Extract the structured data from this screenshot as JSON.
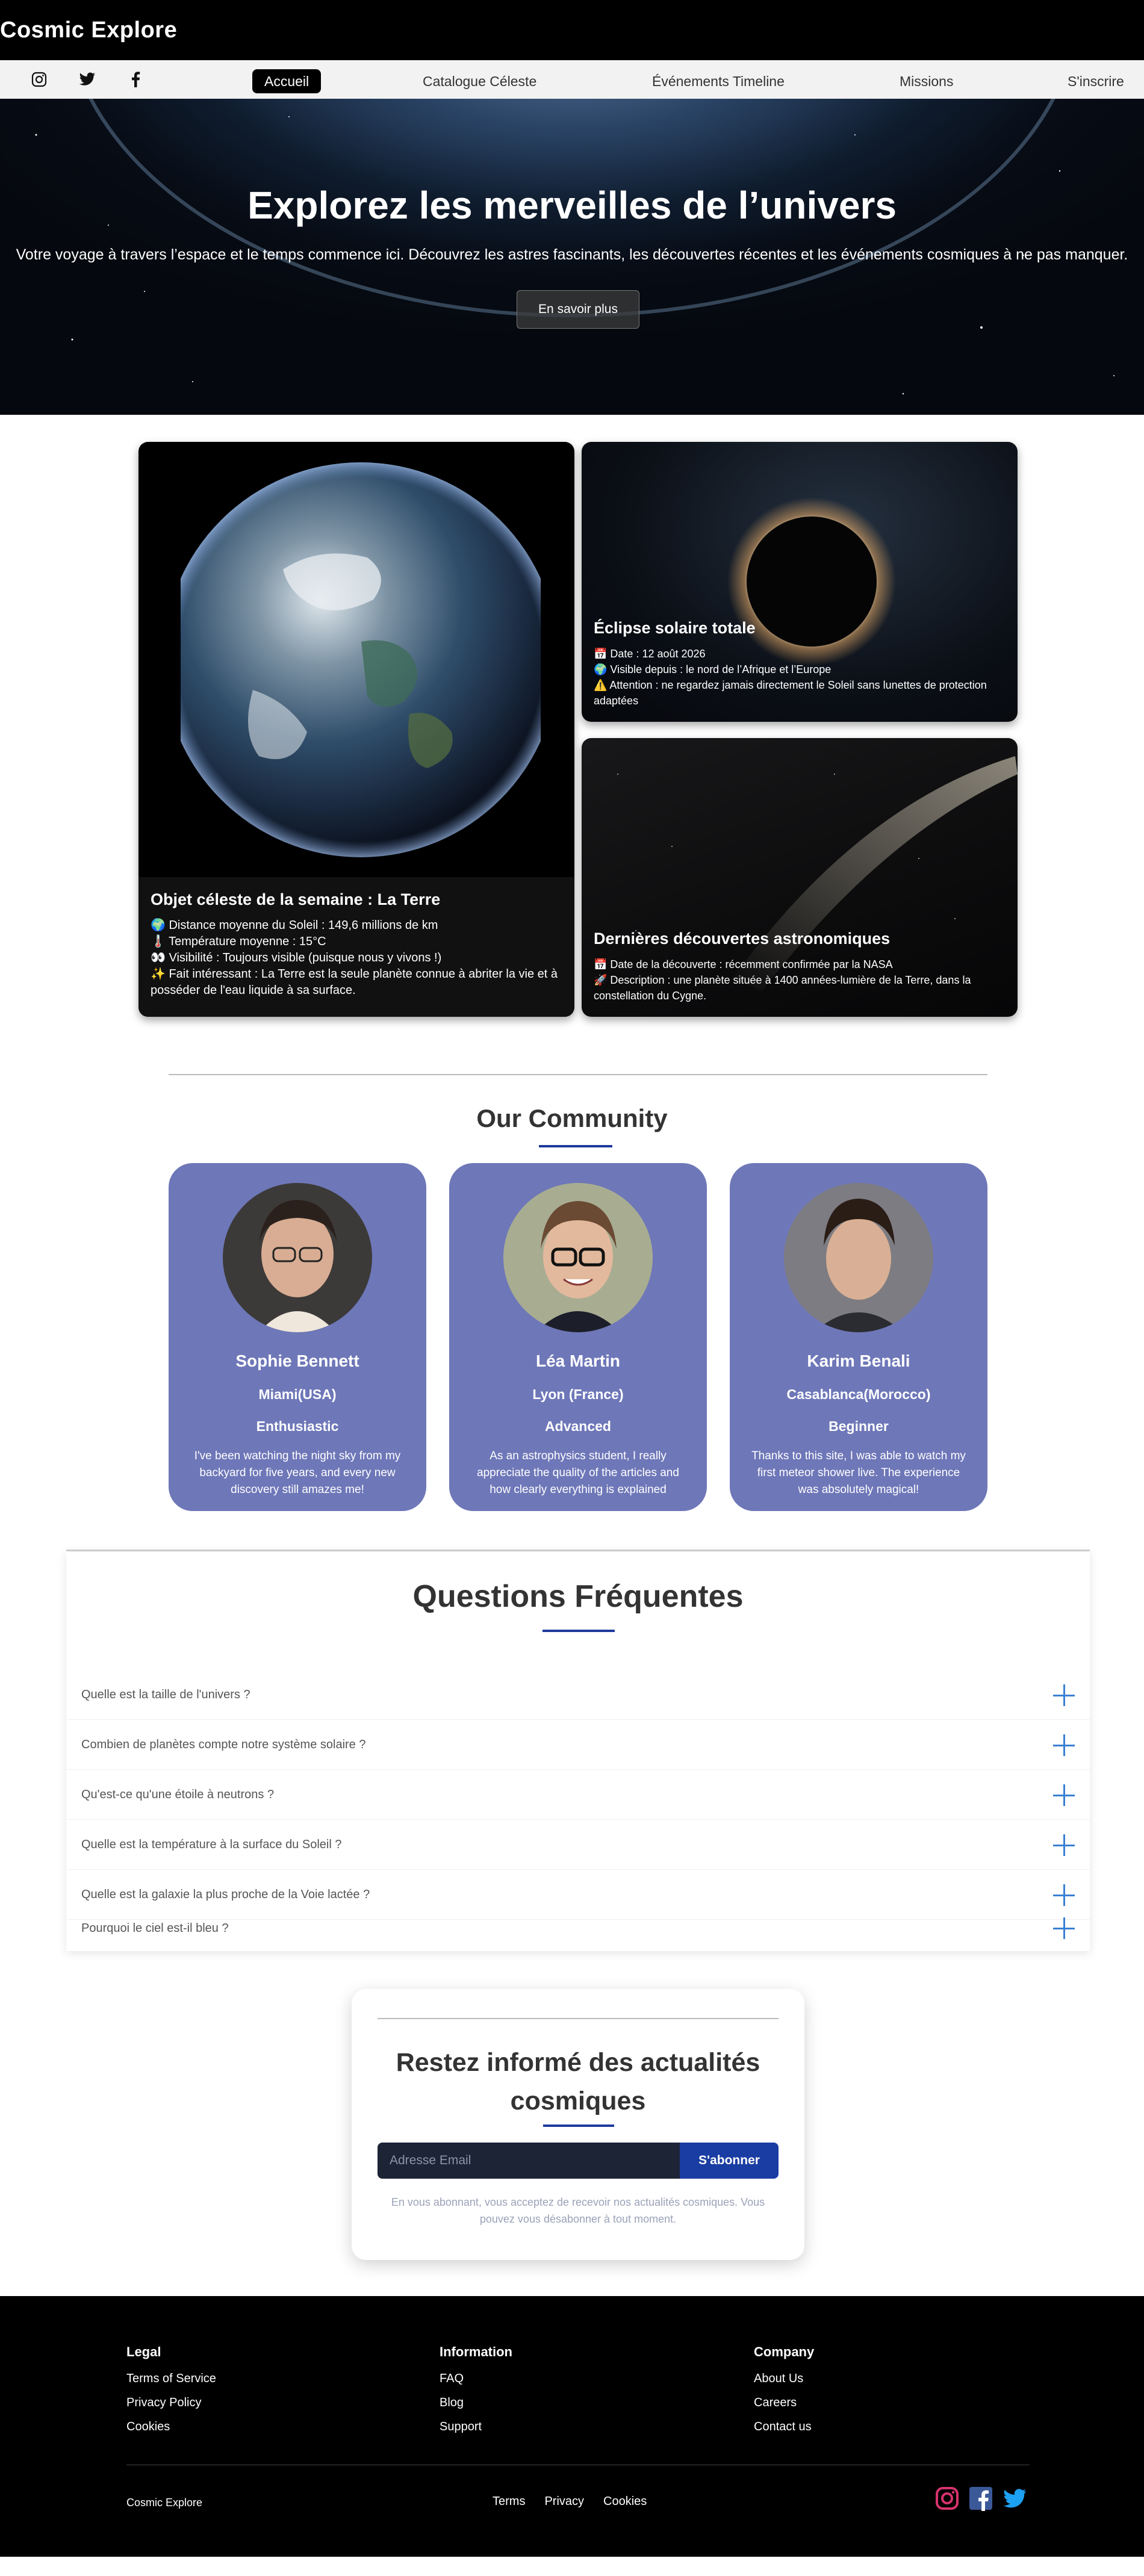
{
  "header": {
    "brand": "Cosmic Explore"
  },
  "nav": {
    "social": [
      "instagram-icon",
      "twitter-icon",
      "facebook-icon"
    ],
    "links": [
      "Accueil",
      "Catalogue Céleste",
      "Événements Timeline",
      "Missions",
      "S'inscrire"
    ],
    "active": "Accueil"
  },
  "hero": {
    "title": "Explorez les merveilles de l’univers",
    "subtitle": "Votre voyage à travers l’espace et le temps commence ici. Découvrez les astres fascinants, les découvertes récentes et les événements cosmiques à ne pas manquer.",
    "button": "En savoir plus"
  },
  "cards": {
    "earth": {
      "title": "Objet céleste de la semaine : La Terre",
      "lines": [
        "🌍 Distance moyenne du Soleil : 149,6 millions de km",
        "🌡️ Température moyenne : 15°C",
        "👀 Visibilité : Toujours visible (puisque nous y vivons !)",
        "✨ Fait intéressant : La Terre est la seule planète connue à abriter la vie et à posséder de l'eau liquide à sa surface."
      ]
    },
    "eclipse": {
      "title": "Éclipse solaire totale",
      "lines": [
        "📅 Date : 12 août 2026",
        "🌍 Visible depuis : le nord de l’Afrique et l’Europe",
        "⚠️ Attention : ne regardez jamais directement le Soleil sans lunettes de protection adaptées"
      ]
    },
    "discovery": {
      "title": "Dernières découvertes astronomiques",
      "lines": [
        "📅 Date de la découverte : récemment confirmée par la NASA",
        "🚀 Description : une planète située à 1400 années-lumière de la Terre, dans la constellation du Cygne."
      ]
    }
  },
  "community": {
    "title": "Our Community",
    "people": [
      {
        "name": "Sophie Bennett",
        "location": "Miami(USA)",
        "level": "Enthusiastic",
        "quote": "I've been watching the night sky from my backyard for five years, and every new discovery still amazes me!"
      },
      {
        "name": "Léa Martin",
        "location": "Lyon (France)",
        "level": "Advanced",
        "quote": "As an astrophysics student, I really appreciate the quality of the articles and how clearly everything is explained"
      },
      {
        "name": "Karim Benali",
        "location": "Casablanca(Morocco)",
        "level": "Beginner",
        "quote": "Thanks to this site, I was able to watch my first meteor shower live. The experience was absolutely magical!"
      }
    ]
  },
  "faq": {
    "title": "Questions Fréquentes",
    "items": [
      "Quelle est la taille de l'univers ?",
      "Combien de planètes compte notre système solaire ?",
      "Qu'est-ce qu'une étoile à neutrons ?",
      "Quelle est la température à la surface du Soleil ?",
      "Quelle est la galaxie la plus proche de la Voie lactée ?",
      "Pourquoi le ciel est-il bleu ?"
    ]
  },
  "newsletter": {
    "title": "Restez informé des actualités cosmiques",
    "placeholder": "Adresse Email",
    "button": "S'abonner",
    "note": "En vous abonnant, vous acceptez de recevoir nos actualités cosmiques. Vous pouvez vous désabonner à tout moment."
  },
  "footer": {
    "columns": [
      {
        "heading": "Legal",
        "links": [
          "Terms of Service",
          "Privacy Policy",
          "Cookies"
        ]
      },
      {
        "heading": "Information",
        "links": [
          "FAQ",
          "Blog",
          "Support"
        ]
      },
      {
        "heading": "Company",
        "links": [
          "About Us",
          "Careers",
          "Contact us"
        ]
      }
    ],
    "brand": "Cosmic Explore",
    "bottom_links": [
      "Terms",
      "Privacy",
      "Cookies"
    ],
    "icons": [
      "instagram-icon",
      "facebook-icon",
      "twitter-icon"
    ],
    "colors": {
      "instagram": "#d6336c",
      "facebook": "#3b5998",
      "twitter": "#1da1f2"
    }
  }
}
